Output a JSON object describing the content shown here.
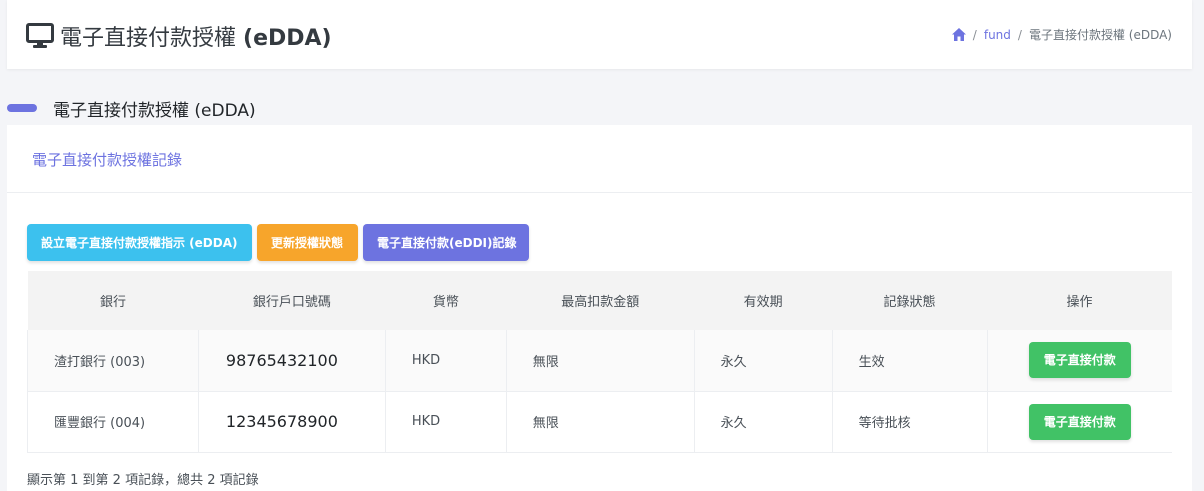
{
  "header": {
    "title_cn": "電子直接付款授權",
    "title_en": "(eDDA)",
    "breadcrumb": {
      "link": "fund",
      "current": "電子直接付款授權 (eDDA)"
    }
  },
  "section": {
    "title": "電子直接付款授權 (eDDA)"
  },
  "card": {
    "heading": "電子直接付款授權記錄",
    "buttons": {
      "setup": "設立電子直接付款授權指示 (eDDA)",
      "update": "更新授權狀態",
      "eddi": "電子直接付款(eDDI)記錄"
    },
    "table": {
      "headers": [
        "銀行",
        "銀行戶口號碼",
        "貨幣",
        "最高扣款金額",
        "有效期",
        "記錄狀態",
        "操作"
      ],
      "rows": [
        {
          "bank": "渣打銀行 (003)",
          "account": "98765432100",
          "currency": "HKD",
          "max": "無限",
          "validity": "永久",
          "status": "生效",
          "action": "電子直接付款"
        },
        {
          "bank": "匯豐銀行 (004)",
          "account": "12345678900",
          "currency": "HKD",
          "max": "無限",
          "validity": "永久",
          "status": "等待批核",
          "action": "電子直接付款"
        }
      ]
    },
    "footer": "顯示第 1 到第 2 項記錄，總共 2 項記錄"
  }
}
